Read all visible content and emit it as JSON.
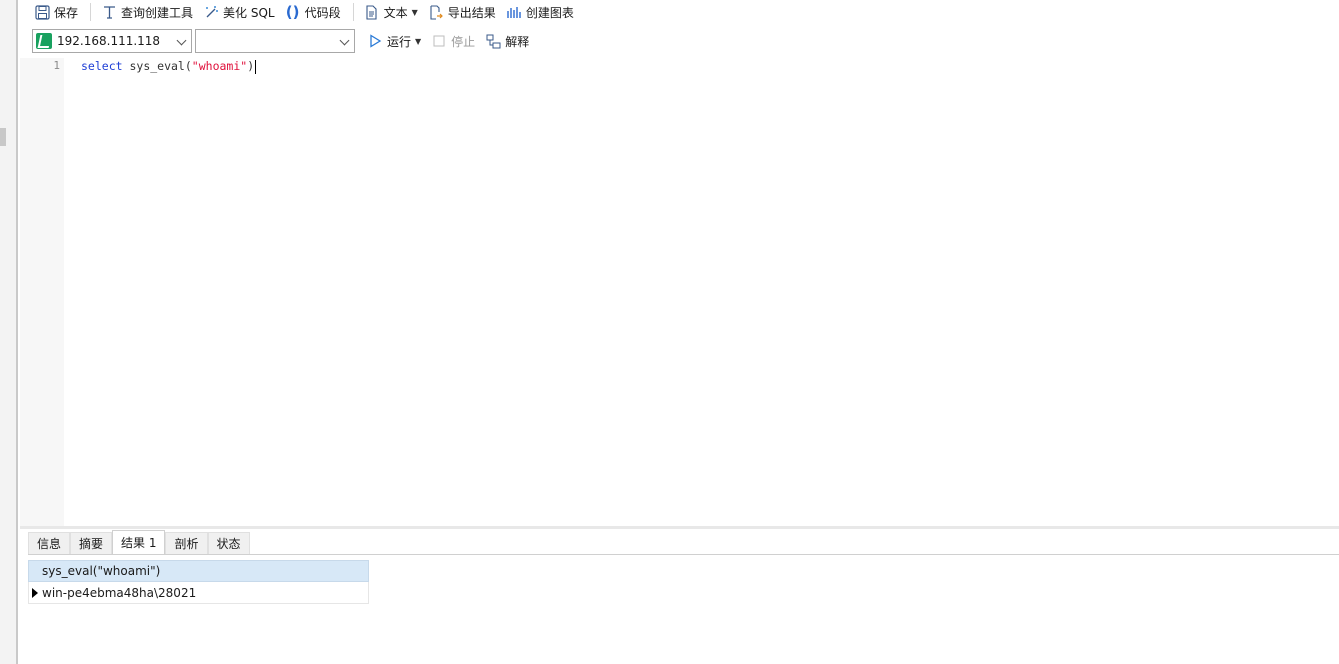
{
  "toolbar": {
    "save": "保存",
    "query_builder": "查询创建工具",
    "beautify_sql": "美化 SQL",
    "code_snippet": "代码段",
    "text": "文本",
    "export_result": "导出结果",
    "create_chart": "创建图表"
  },
  "connection_bar": {
    "connection": "192.168.111.118",
    "database": "",
    "run": "运行",
    "stop": "停止",
    "explain": "解释"
  },
  "editor": {
    "line_number": "1",
    "code": {
      "keyword": "select",
      "function": " sys_eval(",
      "string": "\"whoami\"",
      "close": ")"
    }
  },
  "result_tabs": [
    "信息",
    "摘要",
    "结果 1",
    "剖析",
    "状态"
  ],
  "active_tab": "结果 1",
  "result_grid": {
    "columns": [
      "sys_eval(\"whoami\")"
    ],
    "rows": [
      [
        "win-pe4ebma48ha\\28021"
      ]
    ]
  },
  "colors": {
    "keyword": "#1f3fd6",
    "string": "#e0103b",
    "header_bg": "#d7e8f7",
    "connection_icon": "#19a15f"
  }
}
